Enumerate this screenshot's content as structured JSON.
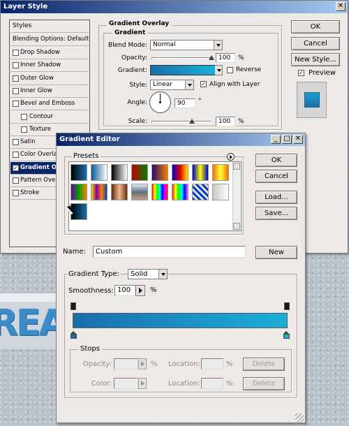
{
  "layer_style": {
    "title": "Layer Style",
    "close_glyph": "✕",
    "styles_header": "Styles",
    "blending_options": "Blending Options: Default",
    "items": [
      {
        "label": "Drop Shadow",
        "checked": false
      },
      {
        "label": "Inner Shadow",
        "checked": false
      },
      {
        "label": "Outer Glow",
        "checked": false
      },
      {
        "label": "Inner Glow",
        "checked": false
      },
      {
        "label": "Bevel and Emboss",
        "checked": false
      },
      {
        "label": "Contour",
        "checked": false
      },
      {
        "label": "Texture",
        "checked": false
      },
      {
        "label": "Satin",
        "checked": false
      },
      {
        "label": "Color Overlay",
        "checked": false
      },
      {
        "label": "Gradient Overlay",
        "checked": true
      },
      {
        "label": "Pattern Overlay",
        "checked": false
      },
      {
        "label": "Stroke",
        "checked": false
      }
    ],
    "section_title": "Gradient Overlay",
    "group_title": "Gradient",
    "blend_mode_label": "Blend Mode:",
    "blend_mode_value": "Normal",
    "opacity_label": "Opacity:",
    "opacity_value": "100",
    "opacity_unit": "%",
    "opacity_fraction": 1.0,
    "gradient_label": "Gradient:",
    "reverse_label": "Reverse",
    "style_label": "Style:",
    "style_value": "Linear",
    "align_label": "Align with Layer",
    "align_checked": true,
    "angle_label": "Angle:",
    "angle_value": "90",
    "angle_unit": "°",
    "scale_label": "Scale:",
    "scale_value": "100",
    "scale_unit": "%",
    "scale_fraction": 0.67,
    "ok_label": "OK",
    "cancel_label": "Cancel",
    "new_style_label": "New Style...",
    "preview_label": "Preview",
    "preview_checked": true
  },
  "gradient_editor": {
    "title": "Gradient Editor",
    "presets_label": "Presets",
    "ok_label": "OK",
    "cancel_label": "Cancel",
    "load_label": "Load...",
    "save_label": "Save...",
    "name_label": "Name:",
    "name_value": "Custom",
    "new_label": "New",
    "gradient_type_label": "Gradient Type:",
    "gradient_type_value": "Solid",
    "smoothness_label": "Smoothness:",
    "smoothness_value": "100",
    "smoothness_unit": "%",
    "stops_label": "Stops",
    "stop_opacity_label": "Opacity:",
    "stop_color_label": "Color:",
    "location_label": "Location:",
    "percent": "%",
    "delete_label": "Delete",
    "gradient_start_color": "#1a6ea9",
    "gradient_end_color": "#1bb0d6",
    "presets": [
      {
        "name": "foreground-to-background",
        "css": "linear-gradient(90deg,#000,#1a6ea9)"
      },
      {
        "name": "foreground-to-transparent",
        "css": "linear-gradient(90deg,#0a5a96,rgba(255,255,255,0))"
      },
      {
        "name": "black-white",
        "css": "linear-gradient(90deg,#000,#fff)"
      },
      {
        "name": "red-green",
        "css": "linear-gradient(90deg,#c00000,#008000)"
      },
      {
        "name": "violet-orange",
        "css": "linear-gradient(90deg,#2a0a6a,#f28000)"
      },
      {
        "name": "blue-red-yellow",
        "css": "linear-gradient(90deg,#0000c8,#e00000,#ffe000)"
      },
      {
        "name": "blue-yellow-blue",
        "css": "linear-gradient(90deg,#0000c8,#ffff00,#0000c8)"
      },
      {
        "name": "orange-yellow-orange",
        "css": "linear-gradient(90deg,#f07000,#ffff40,#f07000)"
      },
      {
        "name": "violet-green-orange",
        "css": "linear-gradient(90deg,#6a00a0,#00a000,#ff8000)"
      },
      {
        "name": "yellow-violet-orange-blue",
        "css": "linear-gradient(90deg,#ffd000,#8000a0,#ff8000,#0040c0)"
      },
      {
        "name": "copper",
        "css": "linear-gradient(90deg,#5a2a10,#f0b890,#6a3010)"
      },
      {
        "name": "chrome",
        "css": "linear-gradient(180deg,#e0e8f0,#607080 50%,#c0a080)"
      },
      {
        "name": "spectrum",
        "css": "linear-gradient(90deg,#f00,#ff0,#0f0,#0ff,#00f,#f0f,#f00)"
      },
      {
        "name": "transparent-rainbow",
        "css": "linear-gradient(90deg,rgba(255,0,0,0.9),#ff0,#0f0,#0ff,#00f,rgba(255,0,255,0.6))"
      },
      {
        "name": "transparent-stripes",
        "css": "repeating-linear-gradient(45deg,#1040c0 0 3px,#e8e8e8 3px 6px)"
      },
      {
        "name": "neutral-density",
        "css": "linear-gradient(90deg,#c8c8c8,#fff)"
      },
      {
        "name": "custom",
        "css": "linear-gradient(90deg,#000,#1a6ea9)"
      }
    ]
  }
}
